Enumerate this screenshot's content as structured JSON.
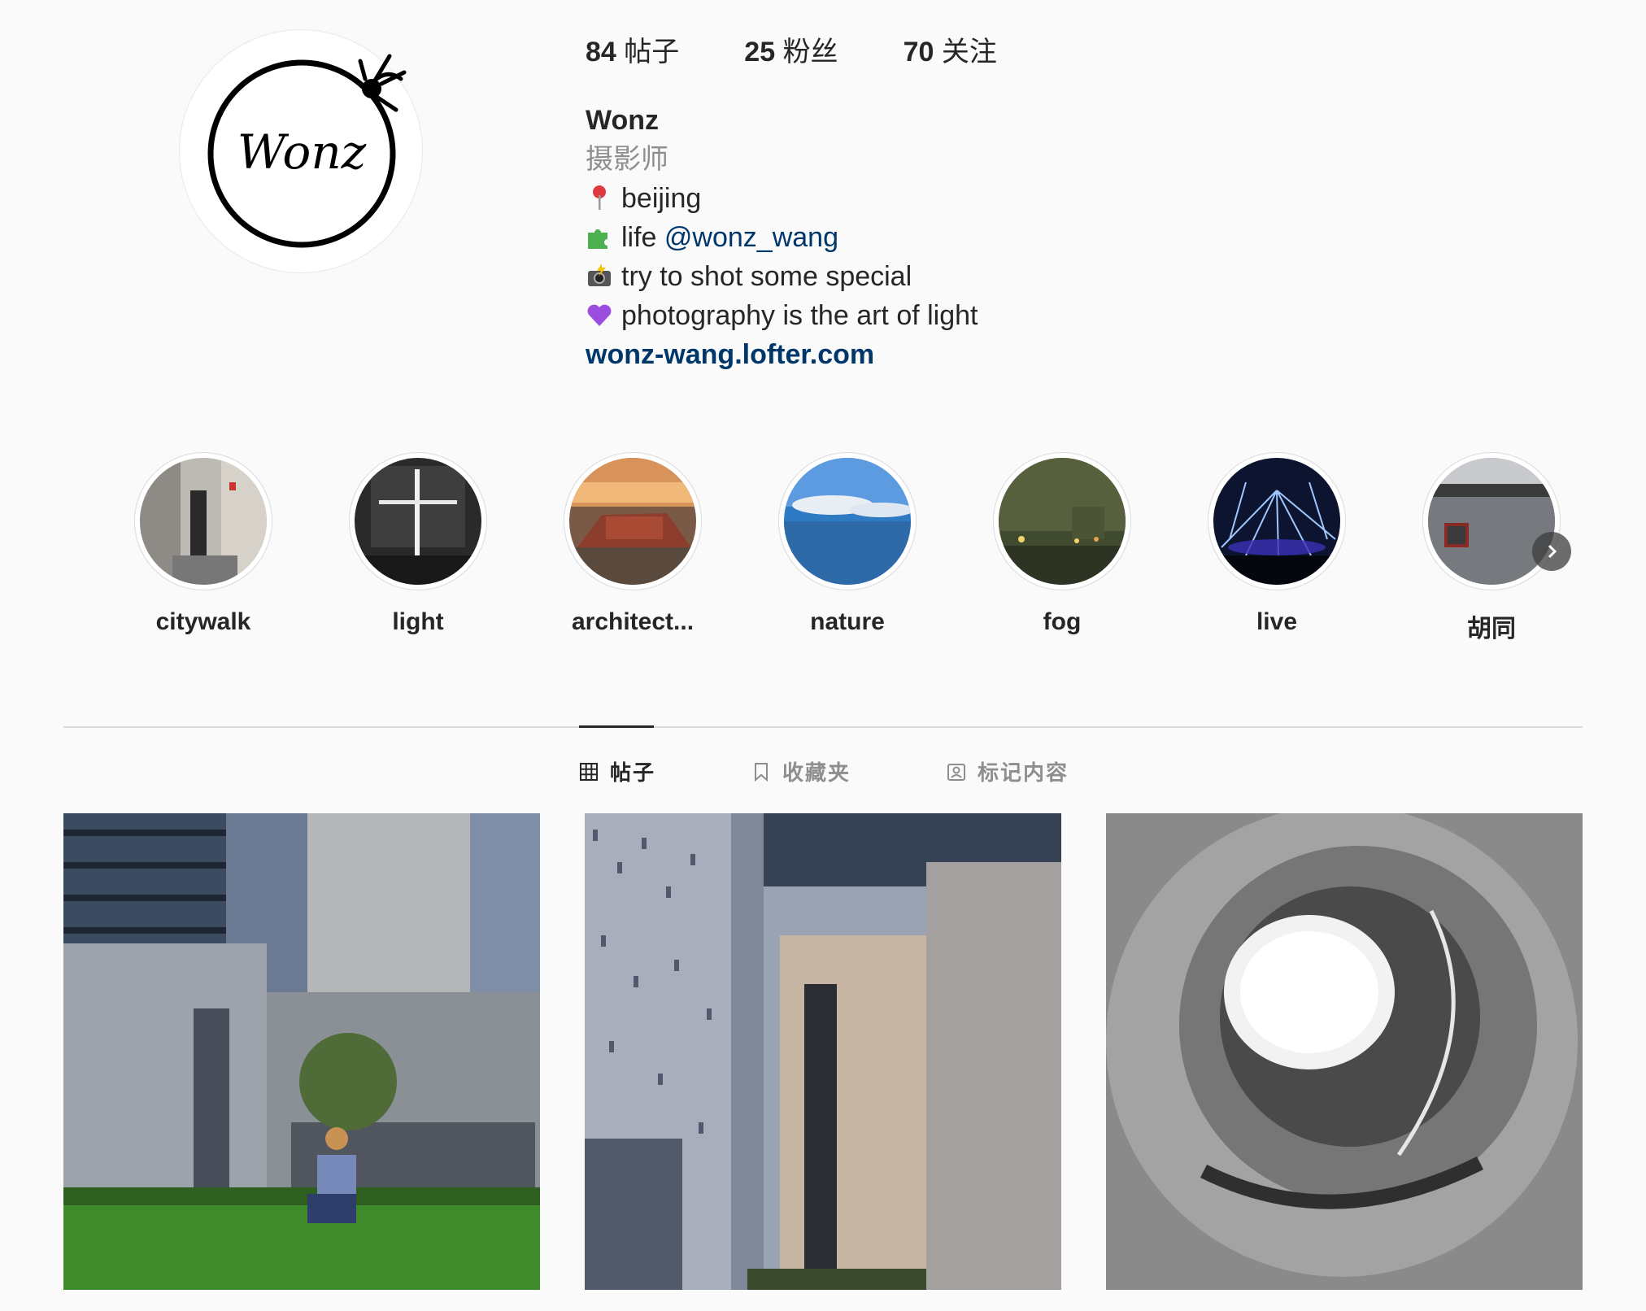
{
  "profile": {
    "stats": [
      {
        "count": "84",
        "label": "帖子"
      },
      {
        "count": "25",
        "label": "粉丝"
      },
      {
        "count": "70",
        "label": "关注"
      }
    ],
    "name": "Wonz",
    "category": "摄影师",
    "bio_lines": [
      {
        "icon": "pin-icon",
        "text": "beijing"
      },
      {
        "icon": "puzzle-icon",
        "text": "life ",
        "mention": "@wonz_wang"
      },
      {
        "icon": "camera-flash-icon",
        "text": "try to shot some special"
      },
      {
        "icon": "purple-heart-icon",
        "text": "photography is the art of light"
      }
    ],
    "website": "wonz-wang.lofter.com",
    "avatar_text": "Wonz"
  },
  "highlights": [
    {
      "label": "citywalk"
    },
    {
      "label": "light"
    },
    {
      "label": "architect..."
    },
    {
      "label": "nature"
    },
    {
      "label": "fog"
    },
    {
      "label": "live"
    },
    {
      "label": "胡同"
    }
  ],
  "tabs": [
    {
      "label": "帖子",
      "icon": "grid-icon",
      "active": true
    },
    {
      "label": "收藏夹",
      "icon": "bookmark-icon",
      "active": false
    },
    {
      "label": "标记内容",
      "icon": "tagged-icon",
      "active": false
    }
  ],
  "colors": {
    "background": "#fafafa",
    "text": "#262626",
    "muted": "#8e8e8e",
    "link": "#00376b"
  }
}
